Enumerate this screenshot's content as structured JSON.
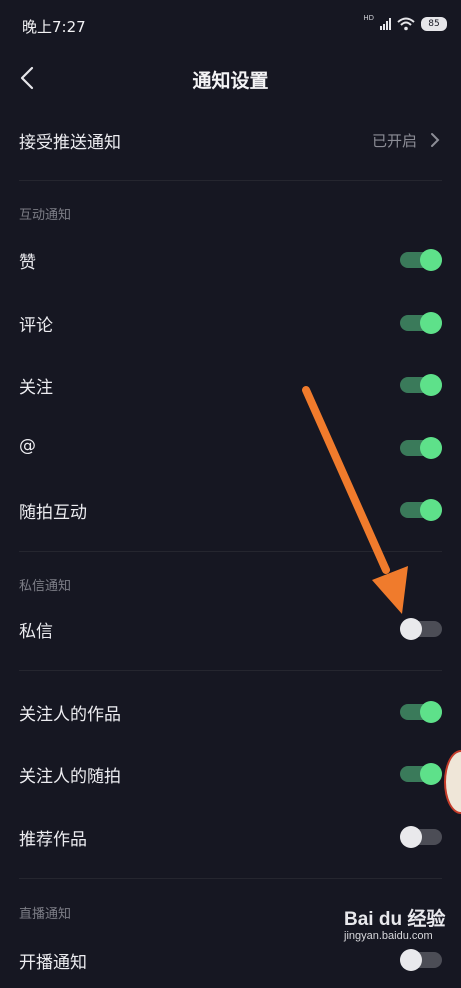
{
  "status_bar": {
    "time": "晚上7:27",
    "network": "HD",
    "battery": "85"
  },
  "header": {
    "title": "通知设置"
  },
  "push": {
    "label": "接受推送通知",
    "status": "已开启"
  },
  "sections": {
    "interaction": "互动通知",
    "messages": "私信通知",
    "live": "直播通知"
  },
  "rows": {
    "like": {
      "label": "赞",
      "on": true
    },
    "comment": {
      "label": "评论",
      "on": true
    },
    "follow": {
      "label": "关注",
      "on": true
    },
    "mention": {
      "label": "@",
      "on": true
    },
    "random": {
      "label": "随拍互动",
      "on": true
    },
    "dm": {
      "label": "私信",
      "on": false
    },
    "following_works": {
      "label": "关注人的作品",
      "on": true
    },
    "following_random": {
      "label": "关注人的随拍",
      "on": true
    },
    "recommended": {
      "label": "推荐作品",
      "on": false
    },
    "live_start": {
      "label": "开播通知",
      "on": false
    }
  },
  "watermark": {
    "brand": "Bai du 经验",
    "url": "jingyan.baidu.com"
  },
  "colors": {
    "toggle_on": "#5ee18a",
    "arrow": "#f07b2c",
    "background": "#161722"
  }
}
